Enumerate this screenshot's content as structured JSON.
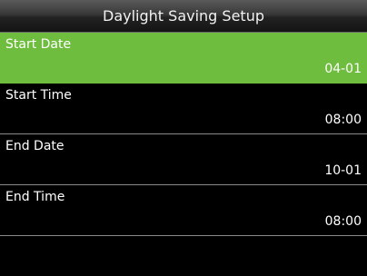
{
  "title": "Daylight Saving Setup",
  "colors": {
    "selected_background": "#6fbd3e",
    "background": "#000000",
    "divider": "#8a8a8a"
  },
  "items": [
    {
      "label": "Start Date",
      "value": "04-01",
      "selected": true
    },
    {
      "label": "Start Time",
      "value": "08:00",
      "selected": false
    },
    {
      "label": "End Date",
      "value": "10-01",
      "selected": false
    },
    {
      "label": "End Time",
      "value": "08:00",
      "selected": false
    }
  ]
}
